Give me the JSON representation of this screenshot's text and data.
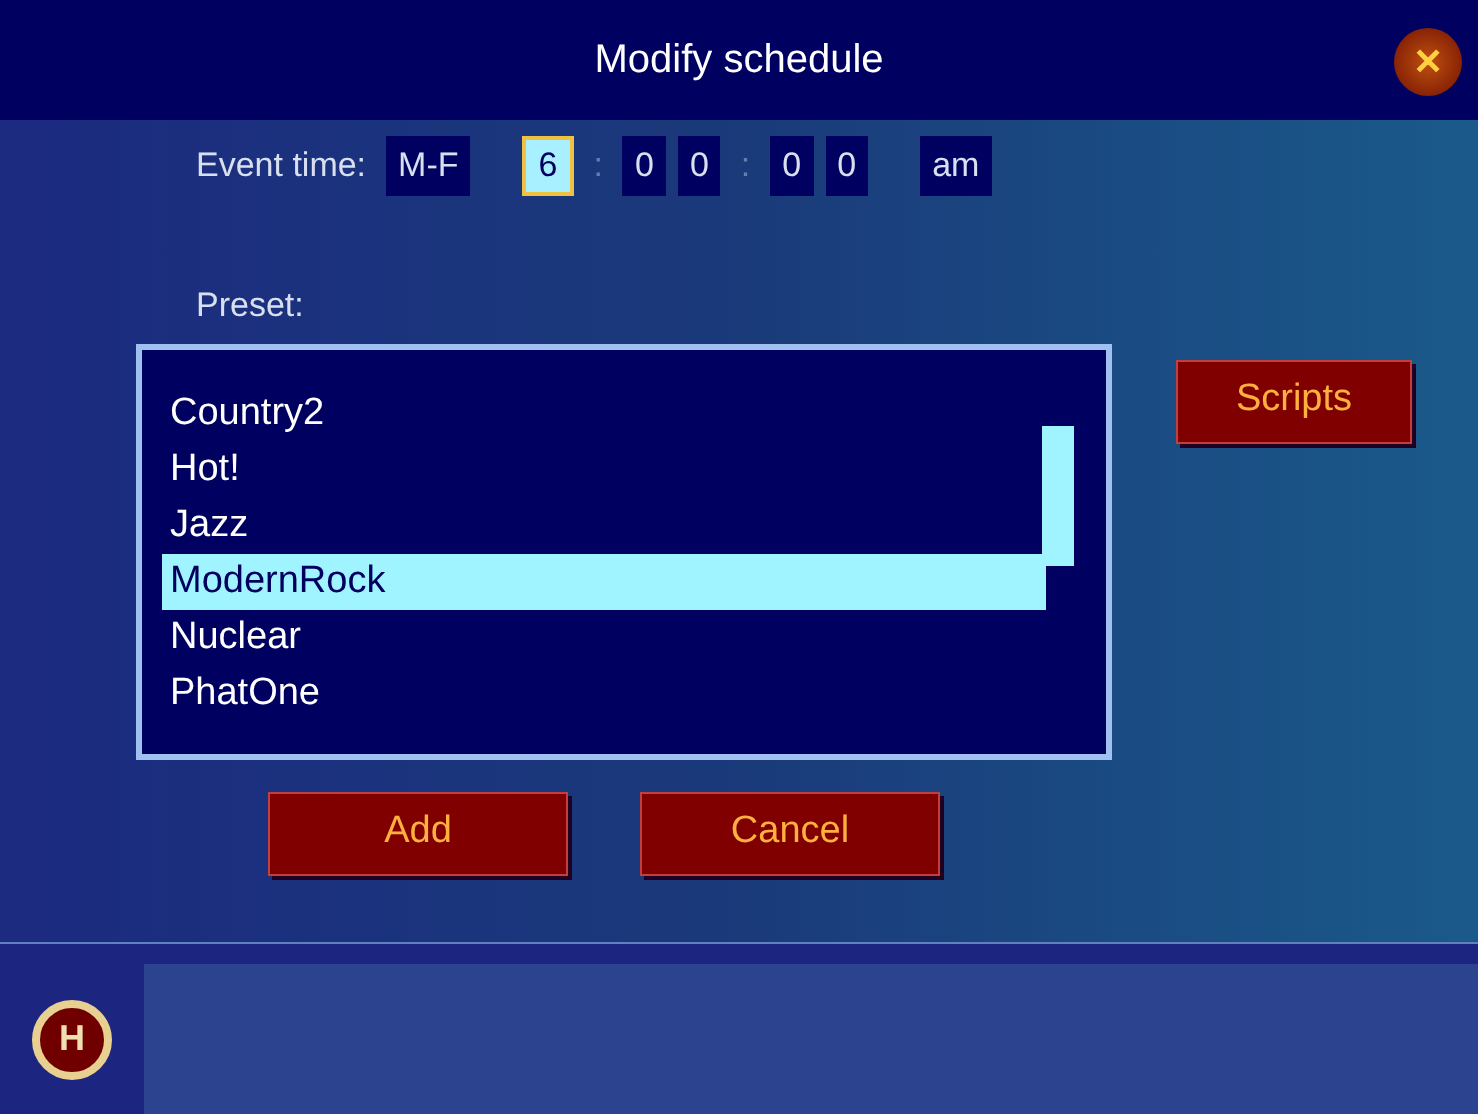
{
  "window": {
    "title": "Modify schedule",
    "close_symbol": "✕"
  },
  "event_time": {
    "label": "Event time:",
    "fields": [
      {
        "kind": "field",
        "value": "M-F",
        "focused": false
      },
      {
        "kind": "gap"
      },
      {
        "kind": "field",
        "value": "6",
        "focused": true
      },
      {
        "kind": "separator",
        "value": ":"
      },
      {
        "kind": "field",
        "value": "0",
        "focused": false
      },
      {
        "kind": "field",
        "value": "0",
        "focused": false
      },
      {
        "kind": "separator",
        "value": ":"
      },
      {
        "kind": "field",
        "value": "0",
        "focused": false
      },
      {
        "kind": "field",
        "value": "0",
        "focused": false
      },
      {
        "kind": "gap"
      },
      {
        "kind": "field",
        "value": "am",
        "focused": false
      }
    ]
  },
  "preset": {
    "label": "Preset:",
    "items": [
      {
        "label": "Country2",
        "selected": false
      },
      {
        "label": "Hot!",
        "selected": false
      },
      {
        "label": "Jazz",
        "selected": false
      },
      {
        "label": "ModernRock",
        "selected": true
      },
      {
        "label": "Nuclear",
        "selected": false
      },
      {
        "label": "PhatOne",
        "selected": false
      }
    ]
  },
  "side_button": "Scripts",
  "buttons": [
    "Add",
    "Cancel"
  ],
  "footer": {
    "logo_letter": "H"
  }
}
